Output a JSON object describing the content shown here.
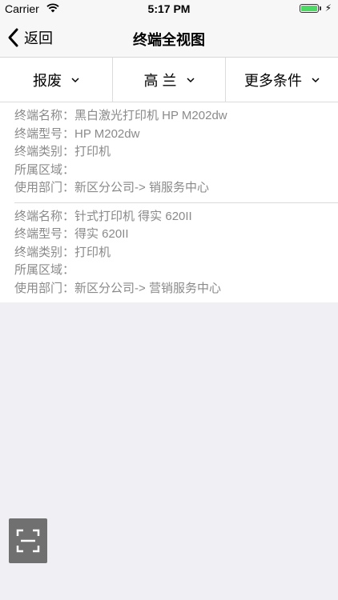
{
  "status_bar": {
    "carrier": "Carrier",
    "time": "5:17 PM"
  },
  "nav": {
    "back_label": "返回",
    "title": "终端全视图"
  },
  "filters": [
    {
      "label": "报废"
    },
    {
      "label": "高 兰"
    },
    {
      "label": "更多条件"
    }
  ],
  "terminals": [
    {
      "fields": [
        {
          "key": "终端名称：",
          "value": "黑白激光打印机 HP M202dw"
        },
        {
          "key": "终端型号：",
          "value": "HP M202dw"
        },
        {
          "key": "终端类别：",
          "value": "打印机"
        },
        {
          "key": "所属区域：",
          "value": ""
        },
        {
          "key": "使用部门：",
          "value": "新区分公司->   销服务中心"
        }
      ]
    },
    {
      "fields": [
        {
          "key": "终端名称：",
          "value": "针式打印机 得实 620II"
        },
        {
          "key": "终端型号：",
          "value": "得实 620II"
        },
        {
          "key": "终端类别：",
          "value": "打印机"
        },
        {
          "key": "所属区域：",
          "value": ""
        },
        {
          "key": "使用部门：",
          "value": "新区分公司->  营销服务中心"
        }
      ]
    }
  ],
  "icons": {
    "back": "chevron-left-icon",
    "caret": "chevron-down-icon",
    "scan": "scan-frame-icon",
    "wifi": "wifi-icon",
    "battery": "battery-icon"
  },
  "colors": {
    "battery": "#4cd964",
    "scan_button": "#707070"
  }
}
